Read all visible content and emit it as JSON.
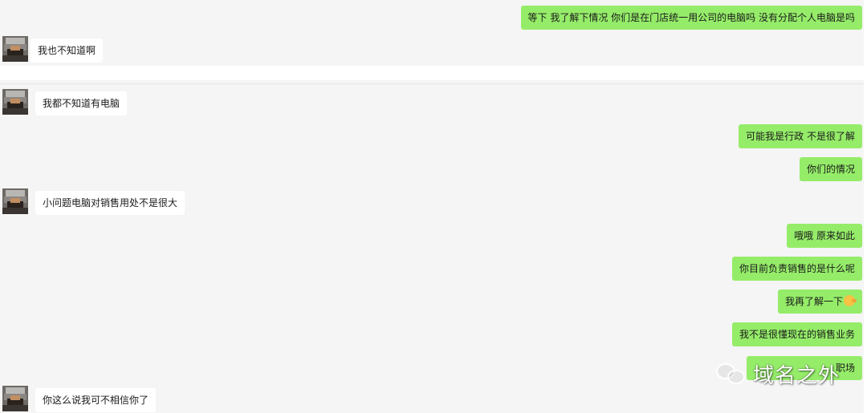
{
  "messages": [
    {
      "sender": "me",
      "text": "等下 我了解下情况 你们是在门店统一用公司的电脑吗  没有分配个人电脑是吗"
    },
    {
      "sender": "them",
      "text": "我也不知道啊"
    },
    {
      "sender": "them",
      "text": "我都不知道有电脑"
    },
    {
      "sender": "me",
      "text": "可能我是行政  不是很了解"
    },
    {
      "sender": "me",
      "text": "你们的情况"
    },
    {
      "sender": "them",
      "text": "小问题电脑对销售用处不是很大"
    },
    {
      "sender": "me",
      "text": "哦哦 原来如此"
    },
    {
      "sender": "me",
      "text": "你目前负责销售的是什么呢"
    },
    {
      "sender": "me",
      "text": "我再了解一下",
      "emoji": "sweat-smile-emoji"
    },
    {
      "sender": "me",
      "text": "我不是很懂现在的销售业务"
    },
    {
      "sender": "me",
      "text": "职场"
    },
    {
      "sender": "them",
      "text": "你这么说我可不相信你了"
    }
  ],
  "watermark": {
    "text": "域名之外",
    "icon": "wechat-logo-icon"
  },
  "colors": {
    "my_bubble": "#95ec69",
    "their_bubble": "#ffffff",
    "background": "#f5f5f5"
  }
}
